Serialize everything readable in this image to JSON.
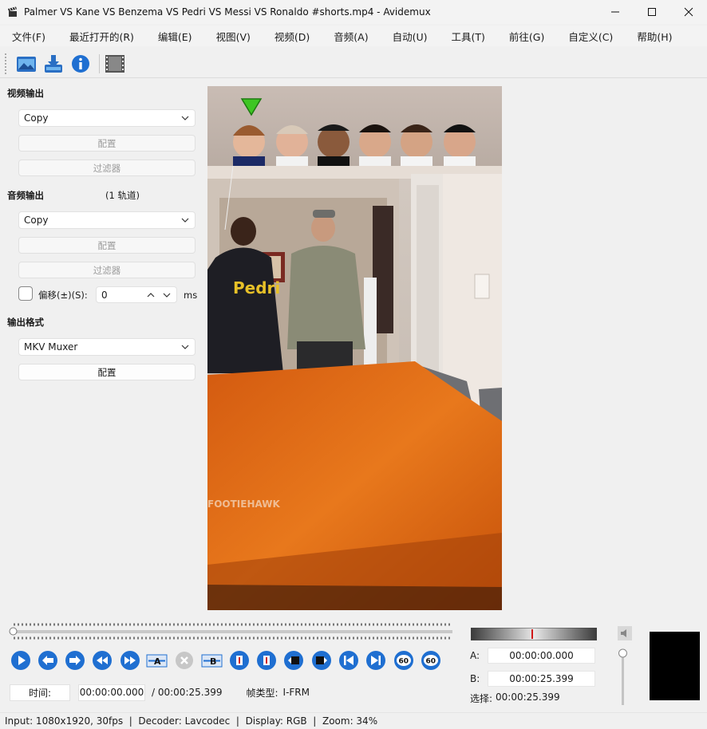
{
  "window": {
    "title": "Palmer VS Kane VS Benzema VS Pedri VS Messi VS Ronaldo #shorts.mp4 - Avidemux"
  },
  "menu": [
    "文件(F)",
    "最近打开的(R)",
    "编辑(E)",
    "视图(V)",
    "视频(D)",
    "音频(A)",
    "自动(U)",
    "工具(T)",
    "前往(G)",
    "自定义(C)",
    "帮助(H)"
  ],
  "toolbar": {
    "icons": [
      "open-video-icon",
      "save-video-icon",
      "info-icon",
      "film-properties-icon"
    ]
  },
  "video_output": {
    "label": "视频输出",
    "codec": "Copy",
    "configure": "配置",
    "filters": "过滤器"
  },
  "audio_output": {
    "label": "音频输出",
    "tracks": "(1 轨道)",
    "codec": "Copy",
    "configure": "配置",
    "filters": "过滤器",
    "shift_label": "偏移(±)(S):",
    "shift_value": "0",
    "shift_unit": "ms"
  },
  "output_format": {
    "label": "输出格式",
    "muxer": "MKV Muxer",
    "configure": "配置"
  },
  "video": {
    "watermark": "FOOTIEHAWK",
    "shirt_text": "Pedri"
  },
  "transport": {
    "buttons": [
      "play-icon",
      "previous-frame-icon",
      "next-frame-icon",
      "rewind-icon",
      "fast-forward-icon",
      "set-marker-a-icon",
      "delete-icon",
      "set-marker-b-icon",
      "goto-marker-a-icon",
      "goto-marker-b-icon",
      "previous-keyframe-icon",
      "next-keyframe-icon",
      "goto-start-icon",
      "goto-end-icon",
      "back-60-icon",
      "forward-60-icon"
    ],
    "back_60": "60",
    "forward_60": "60",
    "marker_a": "A",
    "marker_b": "B"
  },
  "time": {
    "label": "时间:",
    "current": "00:00:00.000",
    "total": "/ 00:00:25.399",
    "frame_type_label": "帧类型:",
    "frame_type": "I-FRM"
  },
  "selection": {
    "a_label": "A:",
    "a_value": "00:00:00.000",
    "b_label": "B:",
    "b_value": "00:00:25.399",
    "selection_label": "选择:",
    "selection_value": "00:00:25.399"
  },
  "status": {
    "input": "Input: 1080x1920, 30fps",
    "decoder": "Decoder: Lavcodec",
    "display": "Display: RGB",
    "zoom": "Zoom: 34%"
  },
  "colors": {
    "accent_blue": "#1f6fd1",
    "table_orange": "#e06a12"
  }
}
